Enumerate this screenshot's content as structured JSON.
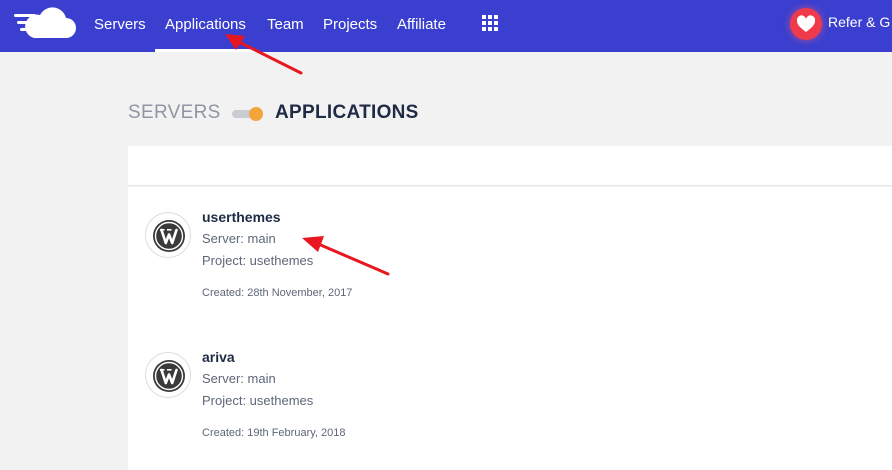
{
  "nav": {
    "items": [
      {
        "label": "Servers",
        "active": false
      },
      {
        "label": "Applications",
        "active": true
      },
      {
        "label": "Team",
        "active": false
      },
      {
        "label": "Projects",
        "active": false
      },
      {
        "label": "Affiliate",
        "active": false
      }
    ],
    "refer_label": "Refer & G"
  },
  "switcher": {
    "left_label": "SERVERS",
    "right_label": "APPLICATIONS",
    "selected": "APPLICATIONS"
  },
  "applications": [
    {
      "name": "userthemes",
      "server": "Server: main",
      "project": "Project: usethemes",
      "created": "Created: 28th November, 2017",
      "icon": "wordpress-icon"
    },
    {
      "name": "ariva",
      "server": "Server: main",
      "project": "Project: usethemes",
      "created": "Created: 19th February, 2018",
      "icon": "wordpress-icon"
    }
  ],
  "colors": {
    "topbar": "#3a3fcf",
    "background": "#f2f2f2",
    "toggle_knob": "#f4a53a",
    "heart": "#ef3a4c",
    "annotation_arrow": "#e8161e"
  },
  "icons": {
    "logo": "cloud-logo-icon",
    "apps_grid": "apps-grid-icon",
    "refer": "heart-icon",
    "app": "wordpress-icon"
  }
}
